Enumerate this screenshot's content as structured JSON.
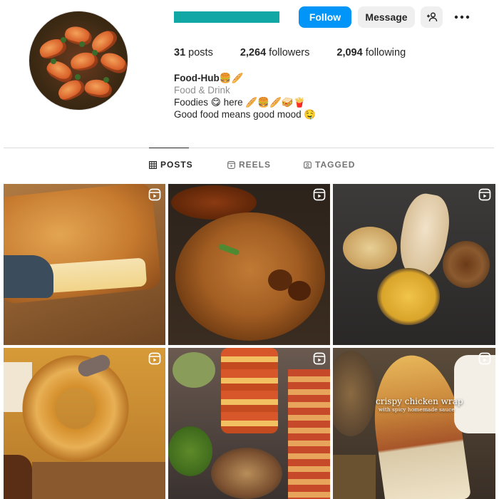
{
  "profile": {
    "posts_count": "31",
    "posts_label": "posts",
    "followers_count": "2,264",
    "followers_label": "followers",
    "following_count": "2,094",
    "following_label": "following"
  },
  "actions": {
    "follow_label": "Follow",
    "message_label": "Message",
    "add_user_icon": "add-user-icon",
    "more_icon": "more-options-icon"
  },
  "bio": {
    "name": "Food-Hub🍔🥖",
    "category": "Food & Drink",
    "line1": "Foodies 😋 here 🥖🍔🥖🥪🍟",
    "line2": "Good food means good mood 🤤"
  },
  "tabs": [
    {
      "label": "POSTS",
      "icon": "grid-icon",
      "active": true
    },
    {
      "label": "REELS",
      "icon": "reels-icon",
      "active": false
    },
    {
      "label": "TAGGED",
      "icon": "tagged-icon",
      "active": false
    }
  ],
  "posts": [
    {
      "subject": "grilled cheese sandwich",
      "reel": true
    },
    {
      "subject": "hakka noodles with manchurian",
      "reel": true
    },
    {
      "subject": "naan with bowls",
      "reel": true
    },
    {
      "subject": "crispy onion rings",
      "reel": true
    },
    {
      "subject": "food stall skewers",
      "reel": true
    },
    {
      "subject": "crispy chicken wrap",
      "reel": true,
      "caption": "crispy chicken wrap",
      "subcaption": "with spicy homemade sauce"
    }
  ],
  "colors": {
    "accent": "#0095f6",
    "username_bar": "#11a7a5",
    "secondary_text": "#8e8e8e"
  }
}
